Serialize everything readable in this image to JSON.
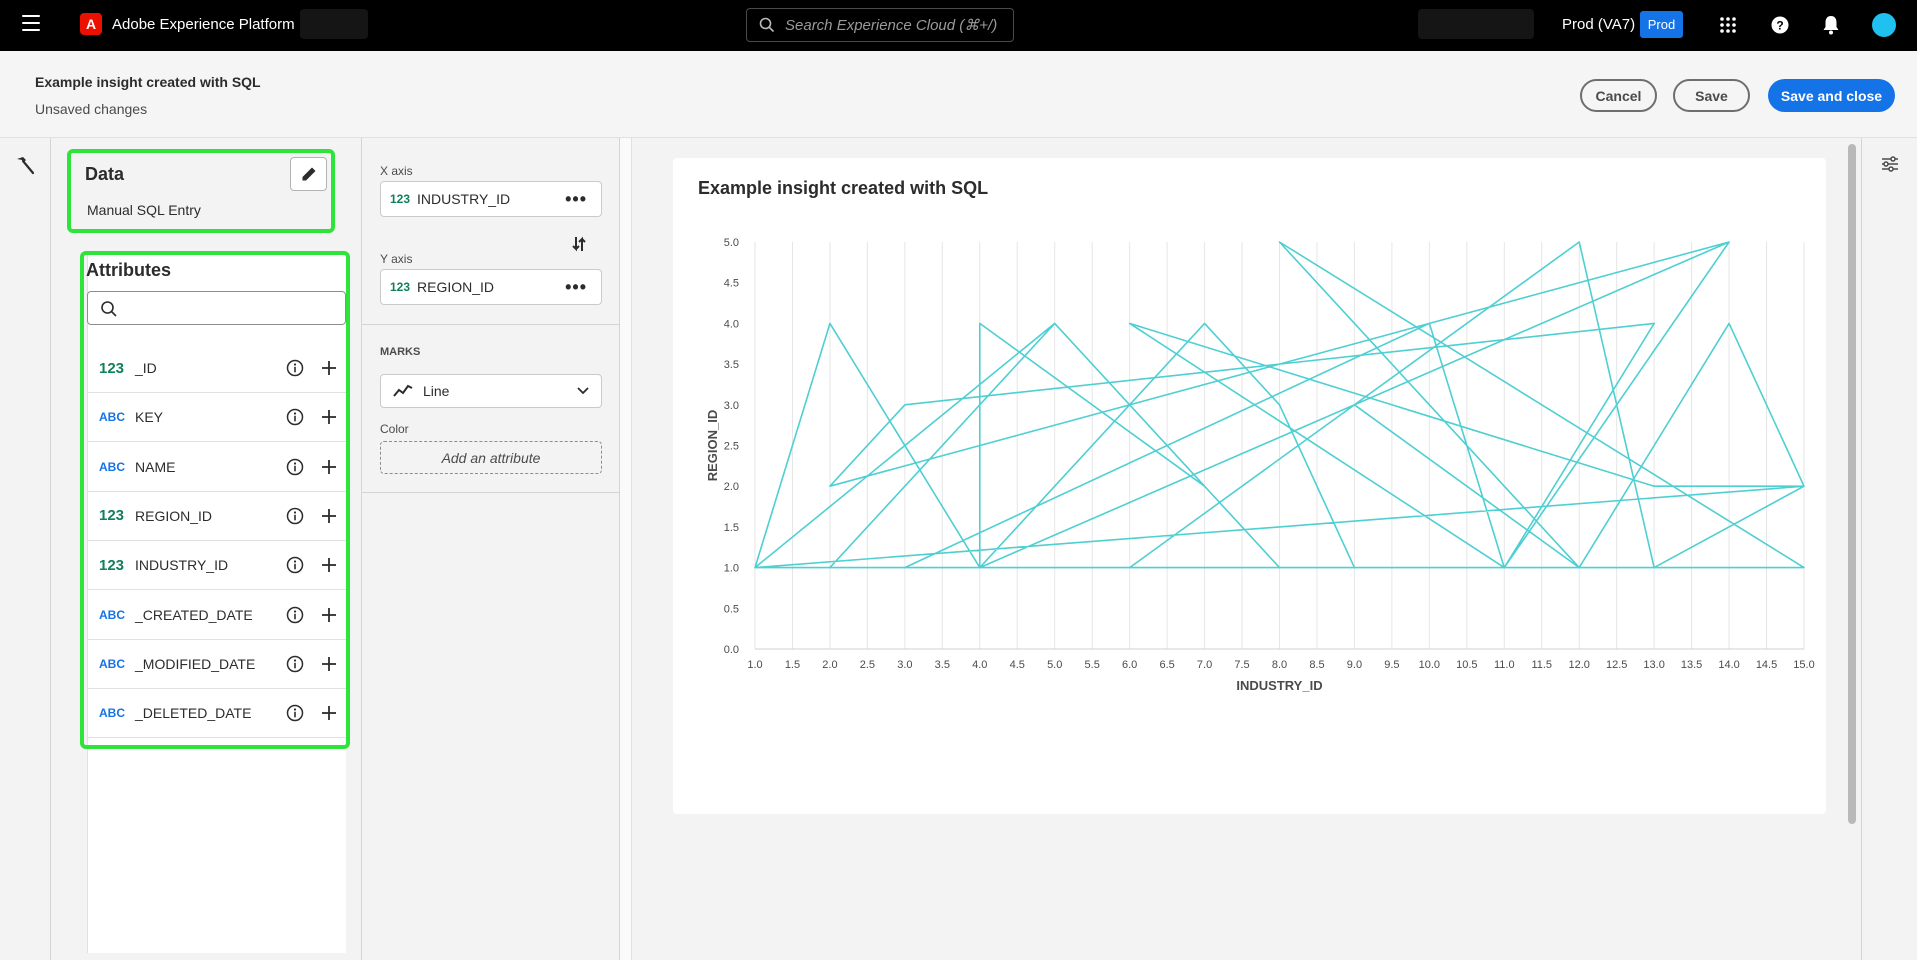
{
  "topbar": {
    "app_name": "Adobe Experience Platform",
    "logo_letter": "A",
    "search_placeholder": "Search Experience Cloud (⌘+/)",
    "env_label": "Prod (VA7)",
    "env_badge": "Prod",
    "icons": [
      "menu-icon",
      "apps-grid-icon",
      "help-icon",
      "notifications-bell-icon",
      "user-avatar"
    ]
  },
  "header": {
    "title": "Example insight created with SQL",
    "subtitle": "Unsaved changes",
    "cancel_label": "Cancel",
    "save_label": "Save",
    "save_close_label": "Save and close"
  },
  "data_panel": {
    "title": "Data",
    "source": "Manual SQL Entry",
    "attributes_title": "Attributes",
    "search_placeholder": "",
    "attributes": [
      {
        "type": "123",
        "kind": "num",
        "name": "_ID"
      },
      {
        "type": "ABC",
        "kind": "str",
        "name": "KEY"
      },
      {
        "type": "ABC",
        "kind": "str",
        "name": "NAME"
      },
      {
        "type": "123",
        "kind": "num",
        "name": "REGION_ID"
      },
      {
        "type": "123",
        "kind": "num",
        "name": "INDUSTRY_ID"
      },
      {
        "type": "ABC",
        "kind": "str",
        "name": "_CREATED_DATE"
      },
      {
        "type": "ABC",
        "kind": "str",
        "name": "_MODIFIED_DATE"
      },
      {
        "type": "ABC",
        "kind": "str",
        "name": "_DELETED_DATE"
      }
    ]
  },
  "encoding": {
    "x_axis_label": "X axis",
    "x_axis_type": "123",
    "x_axis_field": "INDUSTRY_ID",
    "y_axis_label": "Y axis",
    "y_axis_type": "123",
    "y_axis_field": "REGION_ID",
    "more": "•••",
    "marks_label": "MARKS",
    "marks_value": "Line",
    "color_label": "Color",
    "color_placeholder": "Add an attribute"
  },
  "colors": {
    "accent": "#1473e6",
    "highlight": "#2ee33a",
    "line": "#4ecfd2",
    "numeric_type": "#12805c",
    "string_type": "#1473e6"
  },
  "chart_data": {
    "type": "line",
    "title": "Example insight created with SQL",
    "xlabel": "INDUSTRY_ID",
    "ylabel": "REGION_ID",
    "xlim": [
      1.0,
      15.0
    ],
    "ylim": [
      0.0,
      5.0
    ],
    "x_ticks": [
      "1.0",
      "1.5",
      "2.0",
      "2.5",
      "3.0",
      "3.5",
      "4.0",
      "4.5",
      "5.0",
      "5.5",
      "6.0",
      "6.5",
      "7.0",
      "7.5",
      "8.0",
      "8.5",
      "9.0",
      "9.5",
      "10.0",
      "10.5",
      "11.0",
      "11.5",
      "12.0",
      "12.5",
      "13.0",
      "13.5",
      "14.0",
      "14.5",
      "15.0"
    ],
    "y_ticks": [
      "0.0",
      "0.5",
      "1.0",
      "1.5",
      "2.0",
      "2.5",
      "3.0",
      "3.5",
      "4.0",
      "4.5",
      "5.0"
    ],
    "grid": "vertical",
    "series": [
      {
        "x": [
          1,
          2,
          5,
          7,
          4,
          4,
          2,
          1,
          6,
          12,
          13,
          15,
          13,
          6,
          11,
          12,
          14,
          15,
          1,
          3,
          10,
          11,
          13,
          3,
          2,
          14,
          9,
          12,
          8,
          15,
          1,
          5,
          8,
          11,
          14,
          4,
          7,
          8,
          9,
          1
        ],
        "y": [
          1,
          1,
          4,
          2,
          4,
          1,
          4,
          1,
          1,
          5,
          1,
          2,
          2,
          4,
          1,
          1,
          4,
          2,
          1,
          1,
          4,
          1,
          4,
          3,
          2,
          5,
          3,
          1,
          5,
          1,
          1,
          4,
          1,
          1,
          5,
          1,
          4,
          3,
          1,
          1
        ]
      }
    ]
  }
}
